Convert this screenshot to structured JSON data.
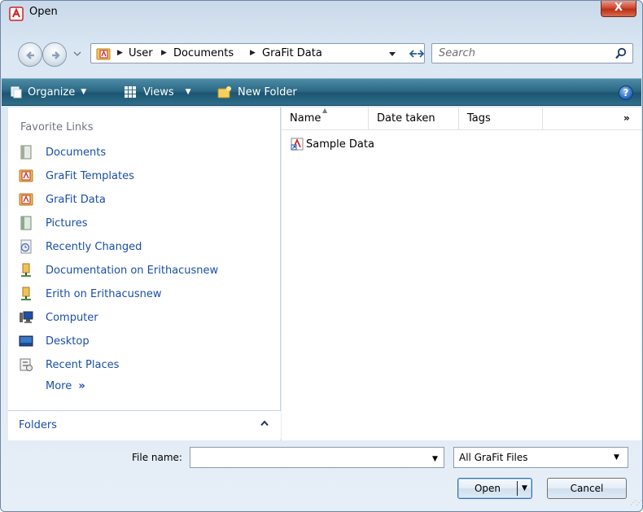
{
  "window": {
    "title": "Open",
    "close_label": "X"
  },
  "address": {
    "crumbs": [
      "User",
      "Documents",
      "GraFit Data"
    ]
  },
  "search": {
    "placeholder": "Search"
  },
  "toolbar": {
    "organize": "Organize",
    "views": "Views",
    "new_folder": "New Folder",
    "help": "?"
  },
  "sidebar": {
    "heading": "Favorite Links",
    "items": [
      {
        "label": "Documents",
        "icon": "documents-icon"
      },
      {
        "label": "GraFit Templates",
        "icon": "grafit-templates-icon"
      },
      {
        "label": "GraFit Data",
        "icon": "grafit-data-icon"
      },
      {
        "label": "Pictures",
        "icon": "pictures-icon"
      },
      {
        "label": "Recently Changed",
        "icon": "recently-changed-icon"
      },
      {
        "label": "Documentation on Erithacusnew",
        "icon": "network-share-icon"
      },
      {
        "label": "Erith on Erithacusnew",
        "icon": "network-share-icon"
      },
      {
        "label": "Computer",
        "icon": "computer-icon"
      },
      {
        "label": "Desktop",
        "icon": "desktop-icon"
      },
      {
        "label": "Recent Places",
        "icon": "recent-places-icon"
      }
    ],
    "more": "More",
    "folders": "Folders"
  },
  "file_list": {
    "columns": [
      "Name",
      "Date taken",
      "Tags"
    ],
    "items": [
      {
        "name": "Sample Data"
      }
    ]
  },
  "footer": {
    "filename_label": "File name:",
    "filename_value": "",
    "filter_value": "All GraFit Files",
    "open_label": "Open",
    "cancel_label": "Cancel"
  }
}
